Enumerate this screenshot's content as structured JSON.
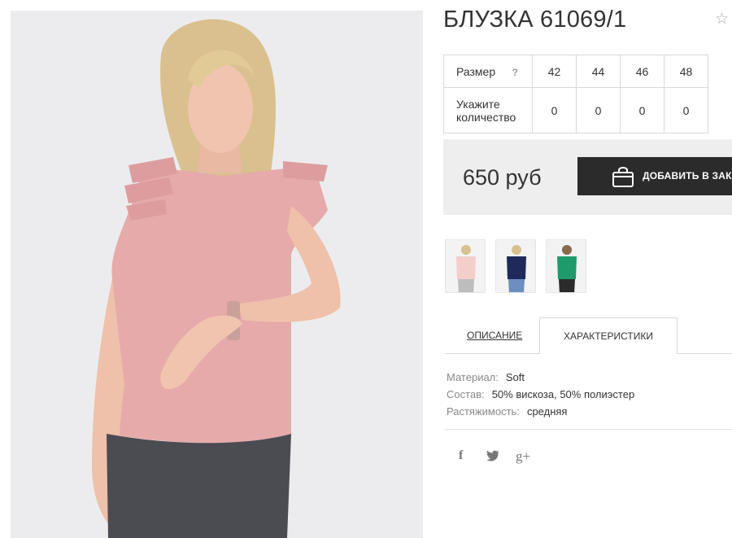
{
  "product": {
    "title": "БЛУЗКА 61069/1",
    "favorite_icon": "star-outline-icon"
  },
  "size_table": {
    "size_label": "Размер",
    "help_label": "?",
    "quantity_label": "Укажите количество",
    "sizes": [
      "42",
      "44",
      "46",
      "48"
    ],
    "quantities": [
      "0",
      "0",
      "0",
      "0"
    ]
  },
  "price": {
    "amount": "650 руб",
    "add_to_cart_label": "ДОБАВИТЬ В ЗАКАЗ",
    "cart_icon": "shopping-bag-icon",
    "button_color": "#2b2b2b"
  },
  "thumbnails": [
    {
      "name": "pink",
      "color": "#f2cfc9"
    },
    {
      "name": "navy",
      "color": "#1f2a5a"
    },
    {
      "name": "green",
      "color": "#1e9a6b"
    }
  ],
  "tabs": {
    "description": "ОПИСАНИЕ",
    "characteristics": "ХАРАКТЕРИСТИКИ"
  },
  "specs": [
    {
      "key": "Материал:",
      "value": "Soft"
    },
    {
      "key": "Состав:",
      "value": "50% вискоза, 50% полиэстер"
    },
    {
      "key": "Растяжимость:",
      "value": "средняя"
    }
  ],
  "social": {
    "facebook": "f",
    "twitter_icon": "twitter-icon",
    "googleplus": "g+"
  }
}
